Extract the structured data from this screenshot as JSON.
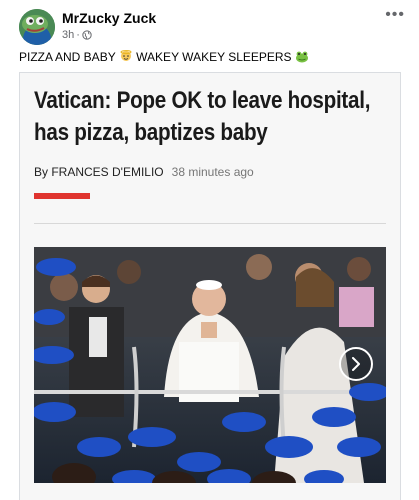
{
  "post": {
    "author": "MrZucky Zuck",
    "time": "3h",
    "privacy_icon": "globe-icon",
    "more_icon": "more-horizontal-icon",
    "caption_part1": "PIZZA AND BABY",
    "caption_part2": "WAKEY WAKEY SLEEPERS",
    "emoji1": "baby-angel-emoji",
    "emoji2": "frog-emoji"
  },
  "article": {
    "headline": "Vatican: Pope OK to leave hospital, has pizza, baptizes baby",
    "byline": "By FRANCES D'EMILIO",
    "time_ago": "38 minutes ago",
    "accent_color": "#e0342f",
    "carousel_next_icon": "chevron-right-icon"
  }
}
